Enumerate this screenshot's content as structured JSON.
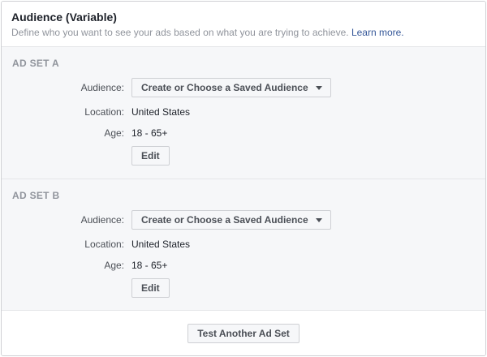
{
  "header": {
    "title": "Audience (Variable)",
    "subtitle": "Define who you want to see your ads based on what you are trying to achieve.",
    "learn_more": "Learn more."
  },
  "ad_sets": [
    {
      "title": "AD SET A",
      "audience_label": "Audience:",
      "audience_value": "Create or Choose a Saved Audience",
      "location_label": "Location:",
      "location_value": "United States",
      "age_label": "Age:",
      "age_value": "18 - 65+",
      "edit_label": "Edit"
    },
    {
      "title": "AD SET B",
      "audience_label": "Audience:",
      "audience_value": "Create or Choose a Saved Audience",
      "location_label": "Location:",
      "location_value": "United States",
      "age_label": "Age:",
      "age_value": "18 - 65+",
      "edit_label": "Edit"
    }
  ],
  "footer": {
    "test_another_label": "Test Another Ad Set"
  },
  "colors": {
    "link": "#365899",
    "section_bg": "#f6f7f9",
    "muted_text": "#90949c"
  }
}
